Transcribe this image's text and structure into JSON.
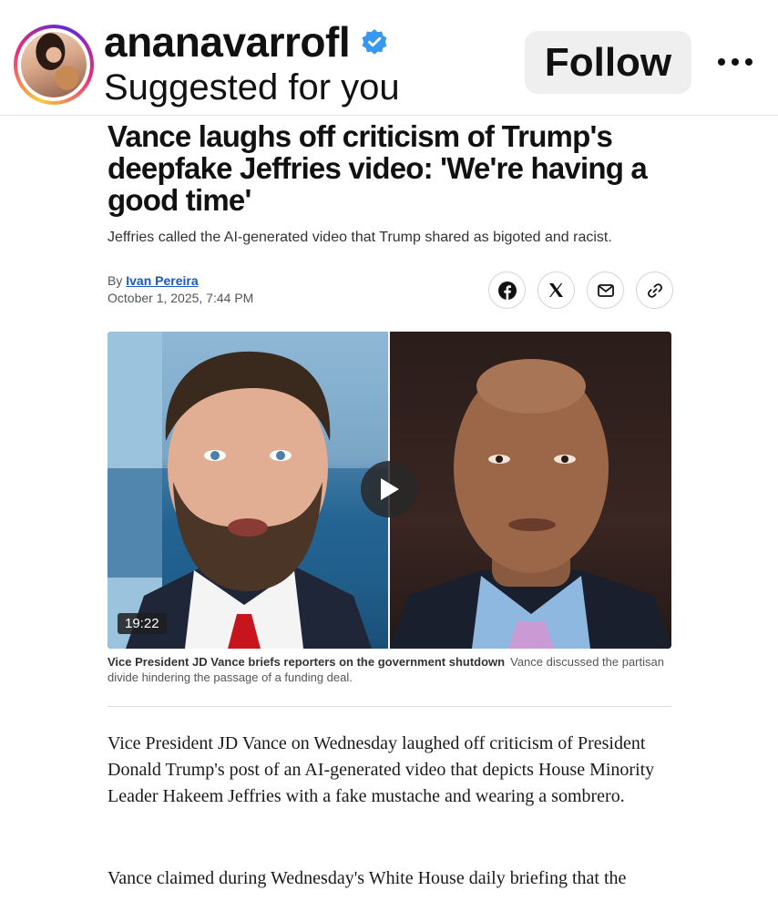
{
  "post": {
    "username": "ananavarrofl",
    "subtitle": "Suggested for you",
    "follow_label": "Follow",
    "verified": true
  },
  "article": {
    "headline": "Vance laughs off criticism of Trump's deepfake Jeffries video: 'We're having a good time'",
    "subhead": "Jeffries called the AI-generated video that Trump shared as bigoted and racist.",
    "byline_prefix": "By",
    "author": "Ivan Pereira",
    "date": "October 1, 2025, 7:44 PM",
    "share_icons": [
      "facebook-icon",
      "x-icon",
      "mail-icon",
      "link-icon"
    ],
    "video": {
      "duration": "19:22"
    },
    "caption_title": "Vice President JD Vance briefs reporters on the government shutdown",
    "caption_text": "Vance discussed the partisan divide hindering the passage of a funding deal.",
    "paragraph1": "Vice President JD Vance on Wednesday laughed off criticism of President Donald Trump's post of an AI-generated video that depicts House Minority Leader Hakeem Jeffries with a fake mustache and wearing a sombrero.",
    "paragraph2": "Vance claimed during Wednesday's White House daily briefing that the"
  },
  "colors": {
    "link": "#1a56c4",
    "verified": "#3897f0",
    "follow_bg": "#efefef"
  }
}
